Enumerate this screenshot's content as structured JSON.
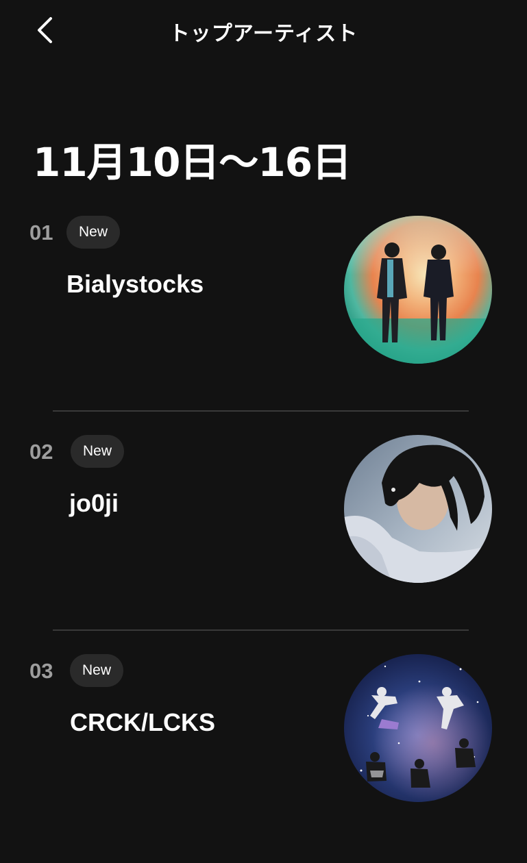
{
  "header": {
    "back_icon": "chevron-left-icon",
    "title": "トップアーティスト"
  },
  "period": {
    "label": "11月10日〜16日"
  },
  "artists": [
    {
      "rank": "01",
      "badge": "New",
      "name": "Bialystocks",
      "image_icon": "artist-photo"
    },
    {
      "rank": "02",
      "badge": "New",
      "name": "jo0ji",
      "image_icon": "artist-photo"
    },
    {
      "rank": "03",
      "badge": "New",
      "name": "CRCK/LCKS",
      "image_icon": "artist-photo"
    }
  ],
  "colors": {
    "background": "#121212",
    "text": "#ffffff",
    "rank": "#9e9e9e",
    "badge_bg": "#2a2a2a",
    "divider": "#3a3a3a"
  }
}
